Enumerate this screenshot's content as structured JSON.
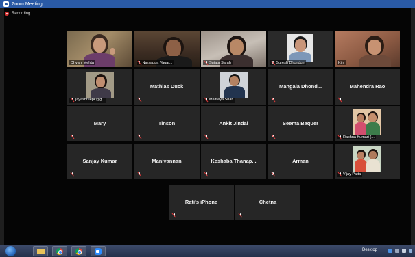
{
  "window": {
    "title": "Zoom Meeting"
  },
  "recording": {
    "label": "Recording"
  },
  "participants": [
    {
      "name": "Dhvani Mehta",
      "video": true
    },
    {
      "name": "Narsappa Vagar...",
      "video": true
    },
    {
      "name": "Sujata Sarah",
      "video": true
    },
    {
      "name": "Suresh Dhondge",
      "video": true
    },
    {
      "name": "Kim",
      "video": true
    },
    {
      "name": "jayashreepk@g...",
      "video": false,
      "photo": true
    },
    {
      "name": "Mathias Duck",
      "video": false
    },
    {
      "name": "Maitreya Shah",
      "video": false,
      "photo": true
    },
    {
      "name": "Mangala Dhond...",
      "video": false
    },
    {
      "name": "Mahendra Rao",
      "video": false
    },
    {
      "name": "Mary",
      "video": false
    },
    {
      "name": "Tinson",
      "video": false
    },
    {
      "name": "Ankit Jindal",
      "video": false
    },
    {
      "name": "Seema Baquer",
      "video": false
    },
    {
      "name": "Rachna Kumari (...",
      "video": false,
      "photo": true
    },
    {
      "name": "Sanjay Kumar",
      "video": false
    },
    {
      "name": "Manivannan",
      "video": false
    },
    {
      "name": "Keshaba Thanap...",
      "video": false
    },
    {
      "name": "Arman",
      "video": false
    },
    {
      "name": "Vijay Patta",
      "video": false,
      "photo": true
    },
    {
      "name": "Rati's iPhone",
      "video": false
    },
    {
      "name": "Chetna",
      "video": false
    }
  ],
  "taskbar": {
    "desktop_label": "Desktop"
  },
  "colors": {
    "active_speaker": "#e6e000",
    "muted": "#e03b3b",
    "titlebar": "#2a5aa6"
  }
}
